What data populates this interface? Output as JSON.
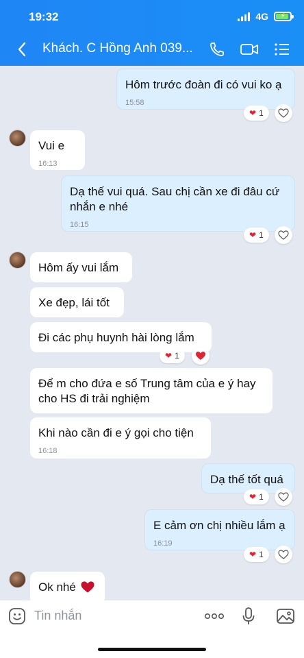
{
  "status_bar": {
    "time": "19:32",
    "network": "4G"
  },
  "header": {
    "title": "Khách. C Hồng Anh 039..."
  },
  "messages": [
    {
      "text": "Hôm trước đoàn đi có vui ko ạ",
      "time": "15:58",
      "reaction_count": "1"
    },
    {
      "text": "Vui e",
      "time": "16:13"
    },
    {
      "text": "Dạ thế vui quá. Sau chị cần xe đi đâu cứ nhắn e nhé",
      "time": "16:15",
      "reaction_count": "1"
    },
    {
      "text": "Hôm ấy vui lắm"
    },
    {
      "text": "Xe đẹp, lái tốt"
    },
    {
      "text": "Đi các phụ huynh hài lòng lắm",
      "reaction_count": "1"
    },
    {
      "text": "Để m cho đứa e số Trung tâm của e ý hay cho HS đi trải nghiệm"
    },
    {
      "text": "Khi nào cần đi e ý gọi cho tiện",
      "time": "16:18"
    },
    {
      "text": "Dạ thế tốt quá",
      "reaction_count": "1"
    },
    {
      "text": "E cảm ơn chị nhiều lắm ạ",
      "time": "16:19",
      "reaction_count": "1"
    },
    {
      "text": "Ok nhé"
    }
  ],
  "input": {
    "placeholder": "Tin nhắn"
  },
  "icons": {
    "back": "chevron-left-icon",
    "call": "phone-icon",
    "video": "video-camera-icon",
    "menu": "list-menu-icon",
    "sticker": "sticker-icon",
    "more": "more-dots-icon",
    "mic": "microphone-icon",
    "image": "image-icon",
    "heart": "heart-icon",
    "heart_outline": "heart-outline-icon"
  },
  "colors": {
    "header": "#1f86f5",
    "outgoing_bubble": "#dcefff",
    "incoming_bubble": "#ffffff",
    "background": "#e4e8f0",
    "heart": "#e02434"
  }
}
